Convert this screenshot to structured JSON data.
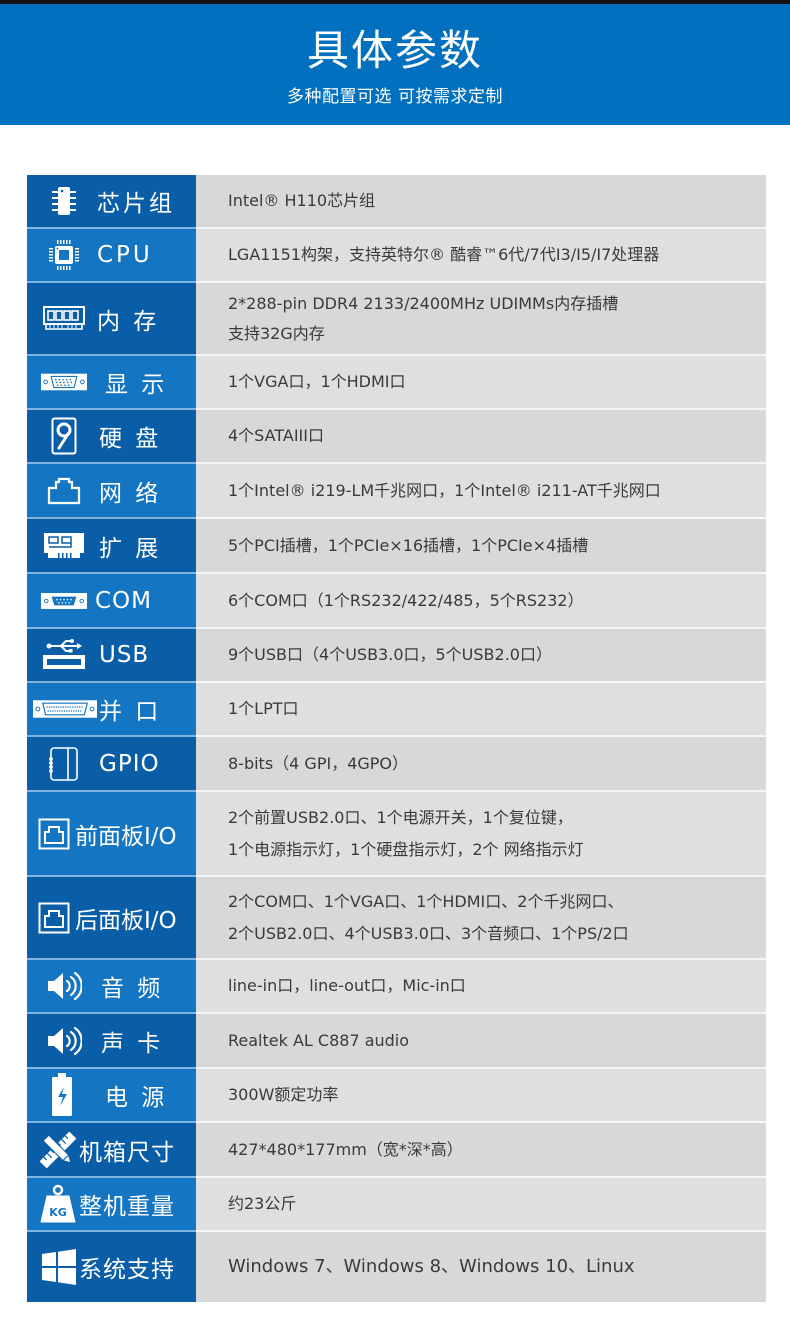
{
  "header": {
    "title": "具体参数",
    "subtitle": "多种配置可选 可按需求定制"
  },
  "colors": {
    "header_blue": "#0070bf",
    "left_dark": "#0a5ea8",
    "left_light": "#1475c2",
    "right_bg": "#d8d8d8",
    "text": "#3a3a3a"
  },
  "specs": [
    {
      "icon": "chip-icon",
      "label": "芯片组",
      "lines": [
        "Intel® H110芯片组"
      ]
    },
    {
      "icon": "cpu-icon",
      "label": "CPU",
      "lines": [
        "LGA1151构架，支持英特尔® 酷睿™6代/7代I3/I5/I7处理器"
      ]
    },
    {
      "icon": "memory-icon",
      "label": "内 存",
      "lines": [
        "2*288-pin DDR4 2133/2400MHz UDIMMs内存插槽",
        "支持32G内存"
      ]
    },
    {
      "icon": "vga-port-icon",
      "label": "显 示",
      "lines": [
        "1个VGA口，1个HDMI口"
      ]
    },
    {
      "icon": "hard-disk-icon",
      "label": "硬 盘",
      "lines": [
        "4个SATAIII口"
      ]
    },
    {
      "icon": "ethernet-port-icon",
      "label": "网 络",
      "lines": [
        "1个Intel® i219-LM千兆网口，1个Intel® i211-AT千兆网口"
      ]
    },
    {
      "icon": "expansion-card-icon",
      "label": "扩 展",
      "lines": [
        "5个PCI插槽，1个PCIe×16插槽，1个PCIe×4插槽"
      ]
    },
    {
      "icon": "serial-port-icon",
      "label": "COM",
      "lines": [
        "6个COM口（1个RS232/422/485，5个RS232）"
      ]
    },
    {
      "icon": "usb-icon",
      "label": "USB",
      "lines": [
        "9个USB口（4个USB3.0口，5个USB2.0口）"
      ]
    },
    {
      "icon": "parallel-port-icon",
      "label": "并 口",
      "lines": [
        "1个LPT口"
      ]
    },
    {
      "icon": "gpio-icon",
      "label": "GPIO",
      "lines": [
        "8-bits（4 GPI，4GPO）"
      ]
    },
    {
      "icon": "front-panel-io-icon",
      "label": "前面板I/O",
      "lines": [
        "2个前置USB2.0口、1个电源开关，1个复位键，",
        "1个电源指示灯，1个硬盘指示灯，2个 网络指示灯"
      ]
    },
    {
      "icon": "rear-panel-io-icon",
      "label": "后面板I/O",
      "lines": [
        "2个COM口、1个VGA口、1个HDMI口、2个千兆网口、",
        "2个USB2.0口、4个USB3.0口、3个音频口、1个PS/2口"
      ]
    },
    {
      "icon": "speaker-icon",
      "label": "音 频",
      "lines": [
        "line-in口，line-out口，Mic-in口"
      ]
    },
    {
      "icon": "speaker-icon",
      "label": "声 卡",
      "lines": [
        "Realtek AL C887 audio"
      ]
    },
    {
      "icon": "battery-icon",
      "label": "电 源",
      "lines": [
        "300W额定功率"
      ]
    },
    {
      "icon": "ruler-pencil-icon",
      "label": "机箱尺寸",
      "lines": [
        "427*480*177mm（宽*深*高）"
      ]
    },
    {
      "icon": "weight-kg-icon",
      "label": "整机重量",
      "lines": [
        "约23公斤"
      ]
    },
    {
      "icon": "windows-icon",
      "label": "系统支持",
      "lines": [
        "Windows 7、Windows 8、Windows 10、Linux"
      ]
    }
  ],
  "icon_text": {
    "kg": "KG"
  }
}
